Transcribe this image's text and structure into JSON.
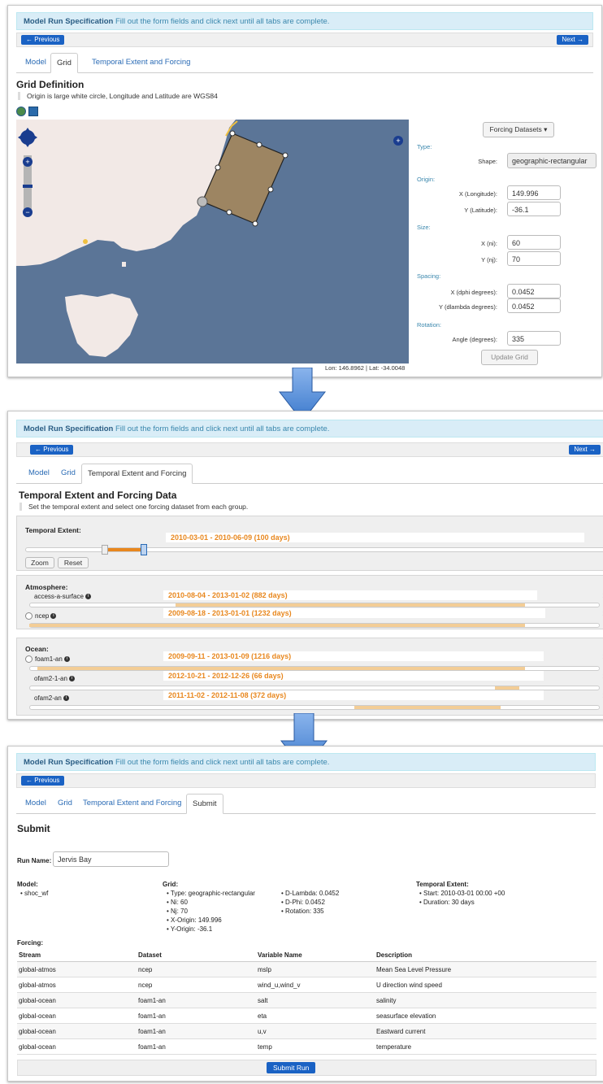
{
  "common": {
    "alert_bold": "Model Run Specification",
    "alert_text": "Fill out the form fields and click next until all tabs are complete.",
    "previous": "← Previous",
    "next": "Next →"
  },
  "tabs": {
    "model": "Model",
    "grid": "Grid",
    "temporal": "Temporal Extent and Forcing",
    "submit": "Submit"
  },
  "grid": {
    "title": "Grid Definition",
    "subtitle": "Origin is large white circle, Longitude and Latitude are WGS84",
    "coord_readout": "Lon: 146.8962 | Lat: -34.0048",
    "forcing_btn": "Forcing Datasets ▾",
    "type_section": "Type:",
    "shape_label": "Shape:",
    "shape_value": "geographic-rectangular",
    "origin_section": "Origin:",
    "x_label": "X (Longitude):",
    "x_value": "149.996",
    "y_label": "Y (Latitude):",
    "y_value": "-36.1",
    "size_section": "Size:",
    "ni_label": "X (ni):",
    "ni_value": "60",
    "nj_label": "Y (nj):",
    "nj_value": "70",
    "spacing_section": "Spacing:",
    "dphi_label": "X (dphi degrees):",
    "dphi_value": "0.0452",
    "dlambda_label": "Y (dlambda degrees):",
    "dlambda_value": "0.0452",
    "rotation_section": "Rotation:",
    "angle_label": "Angle (degrees):",
    "angle_value": "335",
    "update_btn": "Update Grid",
    "colors": {
      "ocean": "#5b7597",
      "land": "#f2e9e6",
      "grid_fill": "#a4875c"
    }
  },
  "temporal": {
    "title": "Temporal Extent and Forcing Data",
    "subtitle": "Set the temporal extent and select one forcing dataset from each group.",
    "extent_label": "Temporal Extent:",
    "extent_range": "2010-03-01 - 2010-06-09 (100 days)",
    "zoom": "Zoom",
    "reset": "Reset",
    "atmos_label": "Atmosphere:",
    "ocean_label": "Ocean:",
    "atmos": [
      {
        "name": "access-a-surface",
        "range": "2010-08-04 - 2013-01-02 (882 days)"
      },
      {
        "name": "ncep",
        "range": "2009-08-18 - 2013-01-01 (1232 days)"
      }
    ],
    "ocean": [
      {
        "name": "foam1-an",
        "range": "2009-09-11 - 2013-01-09 (1216 days)"
      },
      {
        "name": "ofam2-1-an",
        "range": "2012-10-21 - 2012-12-26 (66 days)"
      },
      {
        "name": "ofam2-an",
        "range": "2011-11-02 - 2012-11-08 (372 days)"
      }
    ]
  },
  "submit": {
    "title": "Submit",
    "run_name_label": "Run Name:",
    "run_name_value": "Jervis Bay",
    "model_label": "Model:",
    "model_value": "shoc_wf",
    "grid_label": "Grid:",
    "grid_items": [
      "Type: geographic-rectangular",
      "Ni: 60",
      "Nj: 70",
      "X-Origin: 149.996",
      "Y-Origin: -36.1"
    ],
    "grid_items2": [
      "D-Lambda: 0.0452",
      "D-Phi: 0.0452",
      "Rotation: 335"
    ],
    "temporal_label": "Temporal Extent:",
    "temporal_items": [
      "Start: 2010-03-01 00:00 +00",
      "Duration: 30 days"
    ],
    "forcing_label": "Forcing:",
    "headers": [
      "Stream",
      "Dataset",
      "Variable Name",
      "Description"
    ],
    "rows": [
      [
        "global-atmos",
        "ncep",
        "mslp",
        "Mean Sea Level Pressure"
      ],
      [
        "global-atmos",
        "ncep",
        "wind_u,wind_v",
        "U direction wind speed"
      ],
      [
        "global-ocean",
        "foam1-an",
        "salt",
        "salinity"
      ],
      [
        "global-ocean",
        "foam1-an",
        "eta",
        "seasurface elevation"
      ],
      [
        "global-ocean",
        "foam1-an",
        "u,v",
        "Eastward current"
      ],
      [
        "global-ocean",
        "foam1-an",
        "temp",
        "temperature"
      ]
    ],
    "submit_btn": "Submit Run"
  }
}
